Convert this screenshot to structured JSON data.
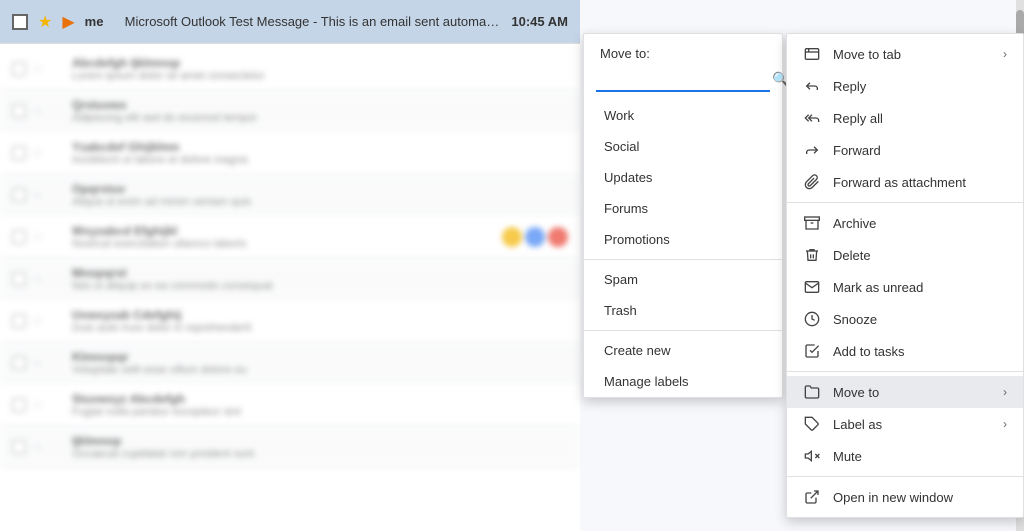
{
  "topbar": {
    "sender": "me",
    "subject": "Microsoft Outlook Test Message",
    "snippet": " - This is an email sent automatically by Microsoft Outlook",
    "time": "10:45 AM"
  },
  "emailRows": [
    {
      "sender": "Abcdefgh Ijklmnop",
      "snippet": "Lorem ipsum dolor sit amet consectetur",
      "time": ""
    },
    {
      "sender": "Qrstuvwx",
      "snippet": "Adipiscing elit sed do eiusmod tempor",
      "time": ""
    },
    {
      "sender": "Yzabcdef Ghijklmn",
      "snippet": "Incididunt ut labore et dolore magna",
      "time": ""
    },
    {
      "sender": "Opqrstuv",
      "snippet": "Aliqua ut enim ad minim veniam quis",
      "time": ""
    },
    {
      "sender": "Wxyzabcd Efghijkl",
      "snippet": "Nostrud exercitation ullamco laboris",
      "avatars": [
        "#f4b400",
        "#4285f4",
        "#ea4335"
      ],
      "time": ""
    },
    {
      "sender": "Mnopqrst",
      "snippet": "Nisi ut aliquip ex ea commodo consequat",
      "time": ""
    },
    {
      "sender": "Uvwxyzab Cdefghij",
      "snippet": "Duis aute irure dolor in reprehenderit",
      "time": ""
    },
    {
      "sender": "Klmnopqr",
      "snippet": "Voluptate velit esse cillum dolore eu",
      "time": ""
    },
    {
      "sender": "Stuvwxyz Abcdefgh",
      "snippet": "Fugiat nulla pariatur excepteur sint",
      "time": ""
    },
    {
      "sender": "Ijklmnop",
      "snippet": "Occaecat cupidatat non proident sunt",
      "time": ""
    }
  ],
  "moveTo": {
    "header": "Move to:",
    "search_placeholder": "",
    "items": [
      "Work",
      "Social",
      "Updates",
      "Forums",
      "Promotions",
      "Spam",
      "Trash"
    ],
    "actions": [
      "Create new",
      "Manage labels"
    ]
  },
  "contextMenu": {
    "items": [
      {
        "label": "Move to tab",
        "icon": "tab",
        "hasArrow": true
      },
      {
        "label": "Reply",
        "icon": "reply",
        "hasArrow": false
      },
      {
        "label": "Reply all",
        "icon": "reply-all",
        "hasArrow": false
      },
      {
        "label": "Forward",
        "icon": "forward",
        "hasArrow": false
      },
      {
        "label": "Forward as attachment",
        "icon": "forward-attach",
        "hasArrow": false
      },
      {
        "label": "divider"
      },
      {
        "label": "Archive",
        "icon": "archive",
        "hasArrow": false
      },
      {
        "label": "Delete",
        "icon": "delete",
        "hasArrow": false
      },
      {
        "label": "Mark as unread",
        "icon": "unread",
        "hasArrow": false
      },
      {
        "label": "Snooze",
        "icon": "snooze",
        "hasArrow": false
      },
      {
        "label": "Add to tasks",
        "icon": "tasks",
        "hasArrow": false
      },
      {
        "label": "divider"
      },
      {
        "label": "Move to",
        "icon": "move",
        "hasArrow": true,
        "active": true
      },
      {
        "label": "Label as",
        "icon": "label",
        "hasArrow": true
      },
      {
        "label": "Mute",
        "icon": "mute",
        "hasArrow": false
      },
      {
        "label": "divider"
      },
      {
        "label": "Open in new window",
        "icon": "open-window",
        "hasArrow": false
      }
    ]
  }
}
